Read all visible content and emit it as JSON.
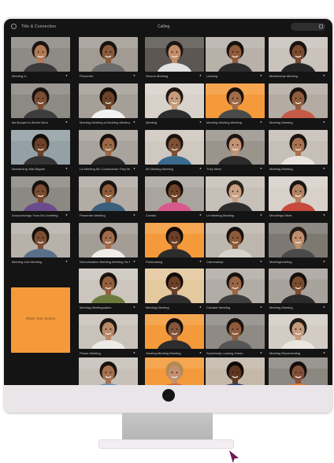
{
  "app": {
    "title": "Title & Connection",
    "status": "Calling",
    "camera_icon": "webcam-icon",
    "pill_icon": "window-icon"
  },
  "colors": {
    "screen": "#141414",
    "accent_orange": "#f49a3a",
    "bezel": "#e9e5e8"
  },
  "featured_tile": {
    "label": "Share Your Screen"
  },
  "participants": [
    {
      "caption": "Meeting Ix",
      "skin": "#b07a55",
      "hair": "#1b1310",
      "shirt": "#3a3a3a",
      "bg": "#8e8a86"
    },
    {
      "caption": "Presenter",
      "skin": "#8a5a3c",
      "hair": "#1a120e",
      "shirt": "#6b6b6b",
      "bg": "#a29b94"
    },
    {
      "caption": "Serene Meeting",
      "skin": "#c18d6b",
      "hair": "#1d1512",
      "shirt": "#e2e2e2",
      "bg": "#5c5753"
    },
    {
      "caption": "Laening",
      "skin": "#8e5b3b",
      "hair": "#16100c",
      "shirt": "#2d2d2d",
      "bg": "#b8b1aa"
    },
    {
      "caption": "Meetenship Meeting",
      "skin": "#7a4b30",
      "hair": "#171110",
      "shirt": "#262626",
      "bg": "#c9c3bc"
    },
    {
      "caption": "Ma Boopel Im Berlin Meni",
      "skin": "#7b4d32",
      "hair": "#1a1310",
      "shirt": "#3d3d3d",
      "bg": "#8d8983"
    },
    {
      "caption": "Meeting Meeting of Meeting Meeting",
      "skin": "#6e4329",
      "hair": "#120d0a",
      "shirt": "#f2f2f2",
      "bg": "#a59f98"
    },
    {
      "caption": "Meeting",
      "skin": "#c69a7a",
      "hair": "#1f1814",
      "shirt": "#2e2e2e",
      "bg": "#d8d2cb"
    },
    {
      "caption": "Meeting Meeting Meeting",
      "skin": "#a06b48",
      "hair": "#18120f",
      "shirt": "#4a4a4a",
      "bg": "#f49a3a"
    },
    {
      "caption": "Meeting Meeting",
      "skin": "#8f5c3d",
      "hair": "#1a120e",
      "shirt": "#c65a48",
      "bg": "#b4aca3"
    },
    {
      "caption": "Meetenship Mal Begran",
      "skin": "#6d4128",
      "hair": "#120d0a",
      "shirt": "#333333",
      "bg": "#93a0a6"
    },
    {
      "caption": "Le Meeting Mo Connectedo They Meetin",
      "skin": "#9b6847",
      "hair": "#15100d",
      "shirt": "#2a2a2a",
      "bg": "#a9a39d"
    },
    {
      "caption": "Mi Meeting Meeting",
      "skin": "#7e5034",
      "hair": "#1a130f",
      "shirt": "#3a6b8c",
      "bg": "#cfc8c0"
    },
    {
      "caption": "They Meet",
      "skin": "#c09373",
      "hair": "#1c1512",
      "shirt": "#2b2b2b",
      "bg": "#9a948d"
    },
    {
      "caption": "Meeting Meeting",
      "skin": "#a87352",
      "hair": "#1a1310",
      "shirt": "#e8e4e0",
      "bg": "#c6bfb8"
    },
    {
      "caption": "Anouchezings Youn Mr Lmeeting",
      "skin": "#7a4a2f",
      "hair": "#14100c",
      "shirt": "#6a4c8c",
      "bg": "#8c8883"
    },
    {
      "caption": "Presenter Meeting",
      "skin": "#8d5a3a",
      "hair": "#181210",
      "shirt": "#3b5f7d",
      "bg": "#b3aca5"
    },
    {
      "caption": "Creator",
      "skin": "#6f4329",
      "hair": "#120d0a",
      "shirt": "#d85a8c",
      "bg": "#a9a49e"
    },
    {
      "caption": "Le Meeting Meeting",
      "skin": "#caa084",
      "hair": "#2a201a",
      "shirt": "#2d2d2d",
      "bg": "#c7c0b8"
    },
    {
      "caption": "Menalings Meet",
      "skin": "#b48262",
      "hair": "#1a1411",
      "shirt": "#c74a3c",
      "bg": "#d8d1ca"
    },
    {
      "caption": "Meeting Ioch Meeting",
      "skin": "#7c4e31",
      "hair": "#15100d",
      "shirt": "#5a6f8a",
      "bg": "#b7b1aa"
    },
    {
      "caption": "Denomination Meeting Meeting Inc Meeting",
      "skin": "#a06c4b",
      "hair": "#1a120e",
      "shirt": "#f1ede9",
      "bg": "#a39d96"
    },
    {
      "caption": "Photorasing",
      "skin": "#6a3e25",
      "hair": "#100b08",
      "shirt": "#2c2c2c",
      "bg": "#f49a3a"
    },
    {
      "caption": "Cameraship",
      "skin": "#8c5a3a",
      "hair": "#16100c",
      "shirt": "#d6d2cd",
      "bg": "#bdb6ae"
    },
    {
      "caption": "Meetinghmeting",
      "skin": "#c18f6c",
      "hair": "#231a15",
      "shirt": "#4b4b4b",
      "bg": "#7d7872"
    },
    {
      "caption": "Meeting Meetingnation",
      "skin": "#94603f",
      "hair": "#1a130f",
      "shirt": "#6c7a3c",
      "bg": "#cbc5be"
    },
    {
      "caption": "Meeting Meeting",
      "skin": "#6c4027",
      "hair": "#110c09",
      "shirt": "#2e2e2e",
      "bg": "#e4c89e"
    },
    {
      "caption": "Creative Meeting",
      "skin": "#9a6644",
      "hair": "#18120f",
      "shirt": "#3f3f3f",
      "bg": "#b2aca6"
    },
    {
      "caption": "Meeting Meeting",
      "skin": "#7b4c30",
      "hair": "#140f0c",
      "shirt": "#2a2a2a",
      "bg": "#a8a29c"
    },
    {
      "caption": "Peace Meeting",
      "skin": "#b88869",
      "hair": "#1d1612",
      "shirt": "#ecebe7",
      "bg": "#c9c2ba"
    },
    {
      "caption": "Gaoling Meeting Meeting",
      "skin": "#86553a",
      "hair": "#15100d",
      "shirt": "#2d2d2d",
      "bg": "#f49a3a"
    },
    {
      "caption": "Somebody Looking Green",
      "skin": "#8d5b3c",
      "hair": "#1a1310",
      "shirt": "#565656",
      "bg": "#8f8a84"
    },
    {
      "caption": "Meeting Representing",
      "skin": "#c49a7c",
      "hair": "#221a16",
      "shirt": "#e9e6e2",
      "bg": "#d3ccc5"
    },
    {
      "caption": "",
      "skin": "#a7714f",
      "hair": "#1a120e",
      "shirt": "#6a8cb0",
      "bg": "#c7c0b9"
    },
    {
      "caption": "",
      "skin": "#c29070",
      "hair": "#b08a55",
      "shirt": "#d0653f",
      "bg": "#f49a3a"
    },
    {
      "caption": "",
      "skin": "#5e3620",
      "hair": "#0f0a07",
      "shirt": "#2d3d6a",
      "bg": "#c4b8aa"
    },
    {
      "caption": "",
      "skin": "#83513a",
      "hair": "#140f0c",
      "shirt": "#e07a28",
      "bg": "#8b8781"
    },
    {
      "caption": "",
      "skin": "#9c6948",
      "hair": "#1a130f",
      "shirt": "#6d8aa8",
      "bg": "#cdc6bf"
    }
  ]
}
